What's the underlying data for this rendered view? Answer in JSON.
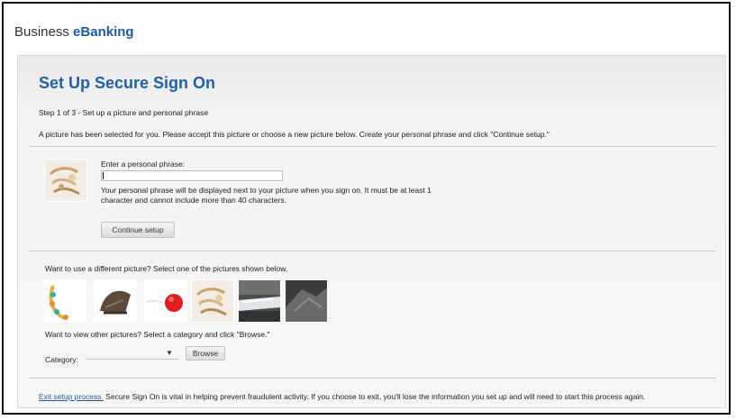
{
  "header": {
    "title_prefix": "Business ",
    "title_brand": "eBanking"
  },
  "main": {
    "page_title": "Set Up Secure Sign On",
    "step_text": "Step 1 of 3 - Set up a picture and personal phrase",
    "intro_text": "A picture has been selected for you. Please accept this picture or choose a new picture below. Create your personal phrase and click \"Continue setup.\"",
    "selected_picture": {
      "icon": "jewelry-picture"
    },
    "phrase": {
      "label": "Enter a personal phrase:",
      "value": "",
      "placeholder": ""
    },
    "help_text": "Your personal phrase will be displayed next to your picture when you sign on. It must be at least 1 character and cannot include more than 40 characters.",
    "continue_label": "Continue setup",
    "different_picture_text": "Want to use a different picture? Select one of the pictures shown below.",
    "pictures": [
      {
        "icon": "necklace-picture"
      },
      {
        "icon": "knit-cap-picture"
      },
      {
        "icon": "red-ball-picture"
      },
      {
        "icon": "jewelry-picture"
      },
      {
        "icon": "waterfall-picture"
      },
      {
        "icon": "rock-picture"
      }
    ],
    "view_other_text": "Want to view other pictures? Select a category and click \"Browse.\"",
    "category_label": "Category:",
    "category_value": "",
    "browse_label": "Browse",
    "exit_link": "Exit setup process.",
    "exit_text": " Secure Sign On is vital in helping prevent fraudulent activity. If you choose to exit, you'll lose the information you set up and will need to start this process again."
  },
  "colors": {
    "brand_blue": "#1f5fad",
    "link_blue": "#1a5aa8",
    "panel_bg": "#f3f3f3"
  }
}
